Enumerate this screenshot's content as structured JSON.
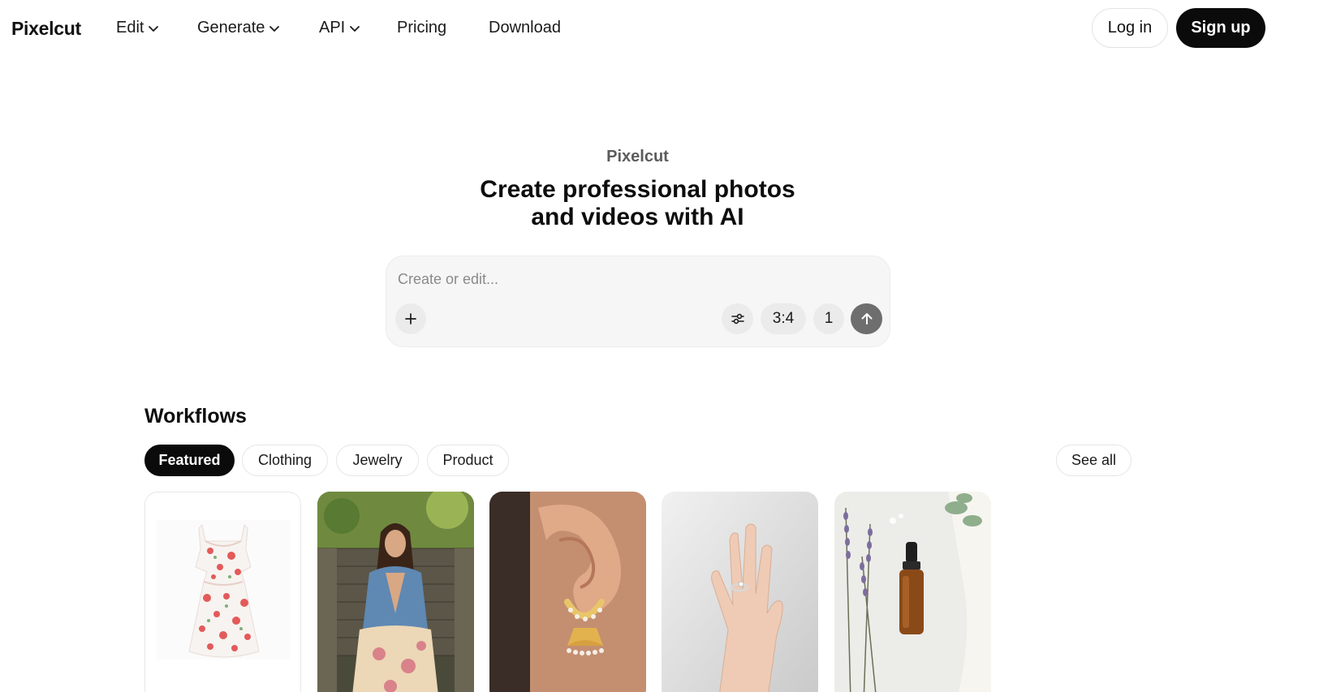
{
  "nav": {
    "logo": "Pixelcut",
    "items": [
      {
        "label": "Edit",
        "has_dropdown": true
      },
      {
        "label": "Generate",
        "has_dropdown": true
      },
      {
        "label": "API",
        "has_dropdown": true
      },
      {
        "label": "Pricing",
        "has_dropdown": false
      },
      {
        "label": "Download",
        "has_dropdown": false
      }
    ],
    "login_label": "Log in",
    "signup_label": "Sign up"
  },
  "hero": {
    "kicker": "Pixelcut",
    "title_line1": "Create professional photos",
    "title_line2": "and videos with AI"
  },
  "prompt": {
    "placeholder": "Create or edit...",
    "value": "",
    "aspect_ratio": "3:4",
    "count": "1",
    "icons": [
      "plus-icon",
      "sliders-icon",
      "arrow-up-icon"
    ]
  },
  "workflows": {
    "title": "Workflows",
    "filters": [
      {
        "label": "Featured",
        "active": true
      },
      {
        "label": "Clothing",
        "active": false
      },
      {
        "label": "Jewelry",
        "active": false
      },
      {
        "label": "Product",
        "active": false
      }
    ],
    "see_all_label": "See all",
    "cards": [
      {
        "subject": "floral-dress-product-shot"
      },
      {
        "subject": "model-in-denim-jacket-on-stairs"
      },
      {
        "subject": "ear-with-gold-jhumka-earring"
      },
      {
        "subject": "hand-with-diamond-ring"
      },
      {
        "subject": "amber-dropper-bottle-with-lavender"
      }
    ]
  },
  "colors": {
    "primary_button": "#0b0b0b",
    "prompt_bg": "#f6f6f6",
    "send_button": "#6e6e6e",
    "muted_text": "#5c5c5c"
  }
}
